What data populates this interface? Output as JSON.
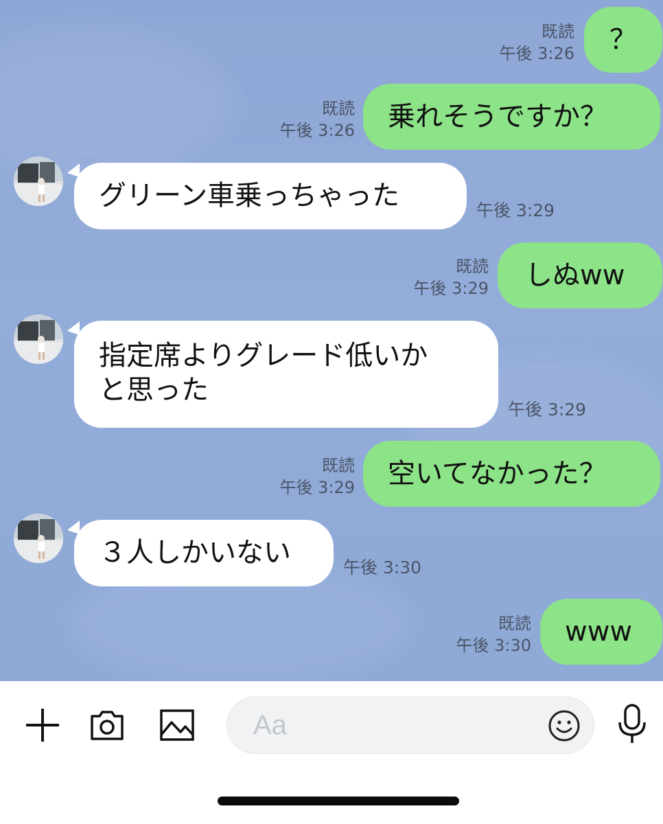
{
  "messages": [
    {
      "side": "out",
      "text": "？",
      "read": "既読",
      "time": "午後 3:26"
    },
    {
      "side": "out",
      "text": "乗れそうですか？",
      "read": "既読",
      "time": "午後 3:26"
    },
    {
      "side": "in",
      "text": "グリーン車乗っちゃった",
      "time": "午後 3:29"
    },
    {
      "side": "out",
      "text": "しぬww",
      "read": "既読",
      "time": "午後 3:29"
    },
    {
      "side": "in",
      "text_lines": [
        "指定席よりグレード低いか",
        "と思った"
      ],
      "time": "午後 3:29"
    },
    {
      "side": "out",
      "text": "空いてなかった？",
      "read": "既読",
      "time": "午後 3:29"
    },
    {
      "side": "in",
      "text": "３人しかいない",
      "time": "午後 3:30"
    },
    {
      "side": "out",
      "text": "www",
      "read": "既読",
      "time": "午後 3:30"
    }
  ],
  "composer": {
    "placeholder": "Aa",
    "icons": [
      "plus-icon",
      "camera-icon",
      "image-icon",
      "emoji-icon",
      "microphone-icon"
    ]
  },
  "colors": {
    "chat_background": "#8faad8",
    "outgoing_bubble": "#8de388",
    "incoming_bubble": "#ffffff",
    "meta_text": "#4b5568"
  }
}
